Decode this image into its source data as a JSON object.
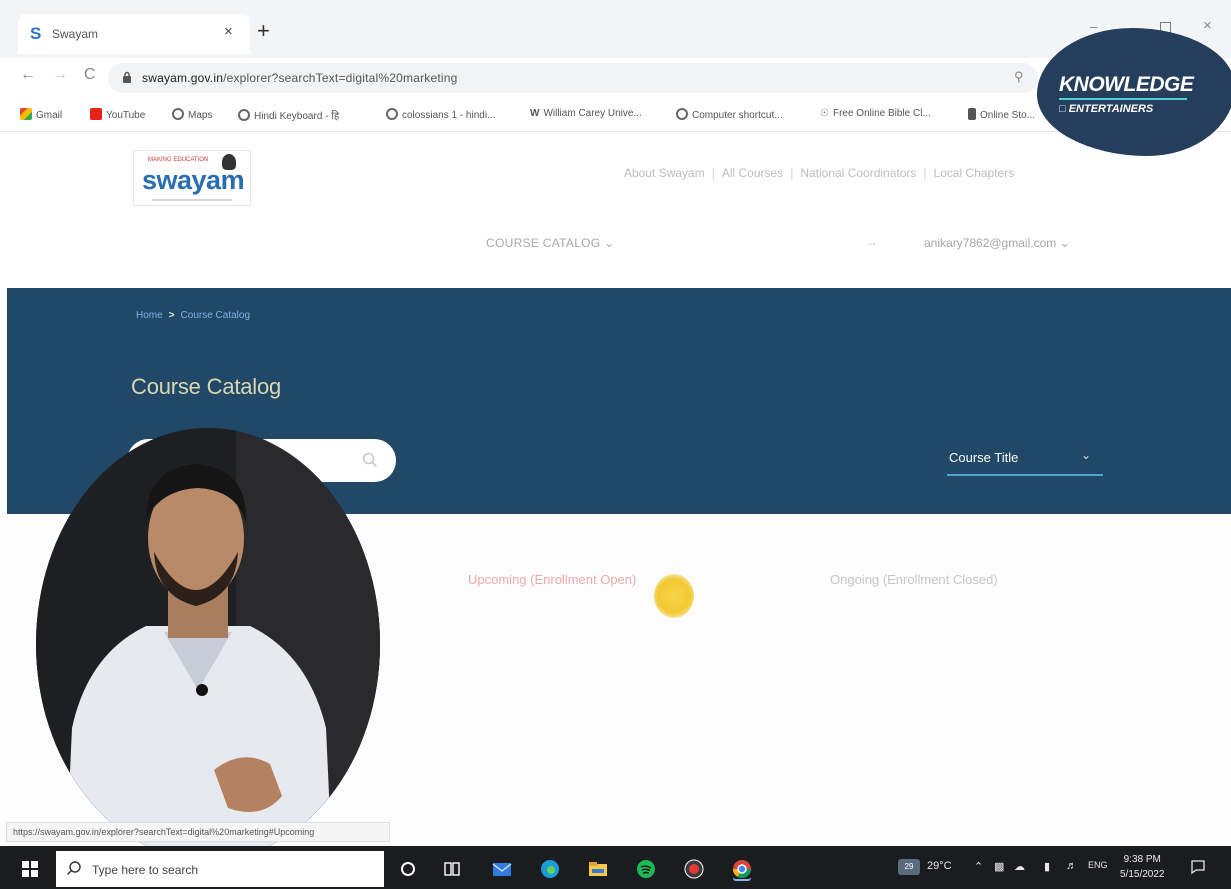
{
  "browser": {
    "tab": {
      "favicon": "S",
      "title": "Swayam",
      "close": "×"
    },
    "new_tab": "+",
    "window_controls": {
      "minimize": "–",
      "close": "×"
    },
    "nav": {
      "back": "←",
      "forward": "→",
      "reload": "C"
    },
    "url": {
      "host": "swayam.gov.in",
      "path": "/explorer?searchText=digital%20marketing"
    },
    "bookmarks": [
      {
        "label": "Gmail",
        "icon": "gmail-icon"
      },
      {
        "label": "YouTube",
        "icon": "youtube-icon"
      },
      {
        "label": "Maps",
        "icon": "globe-icon"
      },
      {
        "label": "Hindi Keyboard - हि",
        "icon": "globe-icon"
      },
      {
        "label": "colossians 1 - hindi...",
        "icon": "globe-icon"
      },
      {
        "label": "William Carey Unive...",
        "icon": "w-icon"
      },
      {
        "label": "Computer shortcut...",
        "icon": "globe-icon"
      },
      {
        "label": "Free Online Bible Cl...",
        "icon": "bulb-icon"
      },
      {
        "label": "Online Sto...",
        "icon": "doc-icon"
      }
    ]
  },
  "watermark": {
    "title": "KNOWLEDGE",
    "subtitle": "ENTERTAINERS"
  },
  "site": {
    "logo_tagline": "MAKING EDUCATION",
    "logo_text": "swayam",
    "top_links": [
      "About Swayam",
      "All Courses",
      "National Coordinators",
      "Local Chapters"
    ],
    "catalog_menu": "COURSE CATALOG",
    "header_arrow": "→",
    "user_email": "anikary7862@gmail.com",
    "breadcrumb": {
      "home": "Home",
      "current": "Course Catalog"
    },
    "page_title": "Course Catalog",
    "sort_label": "Course Title",
    "filters": {
      "upcoming": "Upcoming (Enrollment Open)",
      "ongoing": "Ongoing (Enrollment Closed)"
    },
    "status_url": "https://swayam.gov.in/explorer?searchText=digital%20marketing#Upcoming"
  },
  "taskbar": {
    "search_placeholder": "Type here to search",
    "weather": "29°C",
    "weather_badge": "29",
    "lang": "ENG",
    "time": "9:38 PM",
    "date": "5/15/2022"
  },
  "colors": {
    "banner": "#214866",
    "accent_blue": "#2b6db3",
    "upcoming_pink": "#f0a8a8",
    "watermark_navy": "#243e5c"
  }
}
